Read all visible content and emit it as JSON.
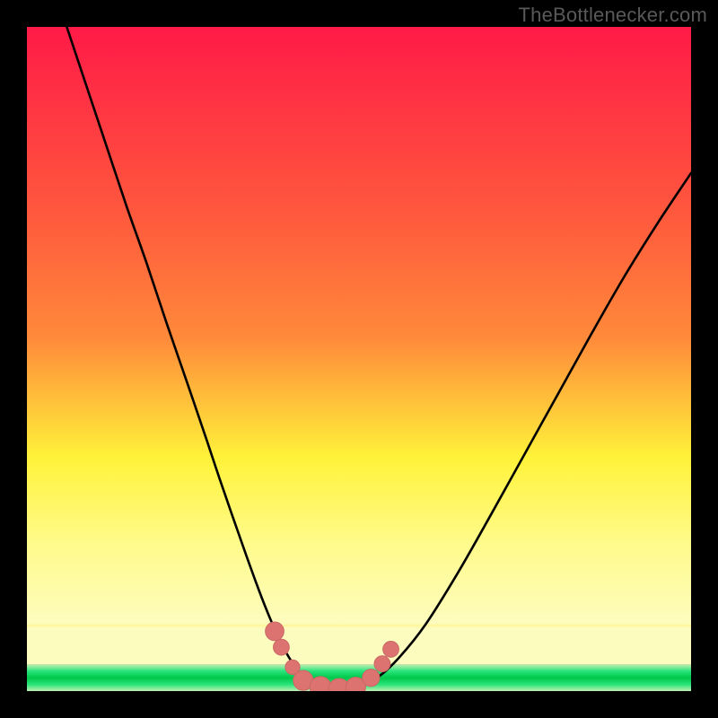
{
  "watermark": "TheBottlenecker.com",
  "colors": {
    "top_red": "#ff1a47",
    "mid_orange": "#ff8a3a",
    "yellow": "#fff23a",
    "pale_yellow": "#fdfcbf",
    "green_edge": "#28e47a",
    "green_core": "#00c74a",
    "curve": "#000000",
    "marker_fill": "#dc7370",
    "marker_stroke": "#c96865"
  },
  "chart_data": {
    "type": "line",
    "title": "",
    "xlabel": "",
    "ylabel": "",
    "xlim": [
      0,
      1
    ],
    "ylim": [
      0,
      1
    ],
    "series": [
      {
        "name": "left-branch",
        "x": [
          0.06,
          0.09,
          0.12,
          0.15,
          0.18,
          0.21,
          0.24,
          0.27,
          0.29,
          0.31,
          0.33,
          0.35,
          0.365,
          0.38,
          0.395,
          0.41,
          0.425,
          0.44
        ],
        "y": [
          1.0,
          0.91,
          0.82,
          0.73,
          0.645,
          0.555,
          0.468,
          0.38,
          0.32,
          0.262,
          0.205,
          0.15,
          0.112,
          0.078,
          0.05,
          0.028,
          0.014,
          0.007
        ]
      },
      {
        "name": "valley-floor",
        "x": [
          0.44,
          0.455,
          0.47,
          0.485,
          0.5
        ],
        "y": [
          0.007,
          0.004,
          0.003,
          0.004,
          0.006
        ]
      },
      {
        "name": "right-branch",
        "x": [
          0.5,
          0.53,
          0.56,
          0.6,
          0.65,
          0.7,
          0.75,
          0.8,
          0.85,
          0.9,
          0.95,
          1.0
        ],
        "y": [
          0.006,
          0.022,
          0.05,
          0.1,
          0.18,
          0.268,
          0.358,
          0.448,
          0.538,
          0.625,
          0.705,
          0.78
        ]
      }
    ],
    "markers": [
      {
        "x": 0.373,
        "y": 0.09,
        "r": 0.014
      },
      {
        "x": 0.383,
        "y": 0.066,
        "r": 0.012
      },
      {
        "x": 0.4,
        "y": 0.036,
        "r": 0.011
      },
      {
        "x": 0.416,
        "y": 0.016,
        "r": 0.015
      },
      {
        "x": 0.442,
        "y": 0.006,
        "r": 0.016
      },
      {
        "x": 0.47,
        "y": 0.003,
        "r": 0.016
      },
      {
        "x": 0.495,
        "y": 0.006,
        "r": 0.015
      },
      {
        "x": 0.518,
        "y": 0.02,
        "r": 0.013
      },
      {
        "x": 0.535,
        "y": 0.041,
        "r": 0.012
      },
      {
        "x": 0.548,
        "y": 0.063,
        "r": 0.012
      }
    ]
  }
}
